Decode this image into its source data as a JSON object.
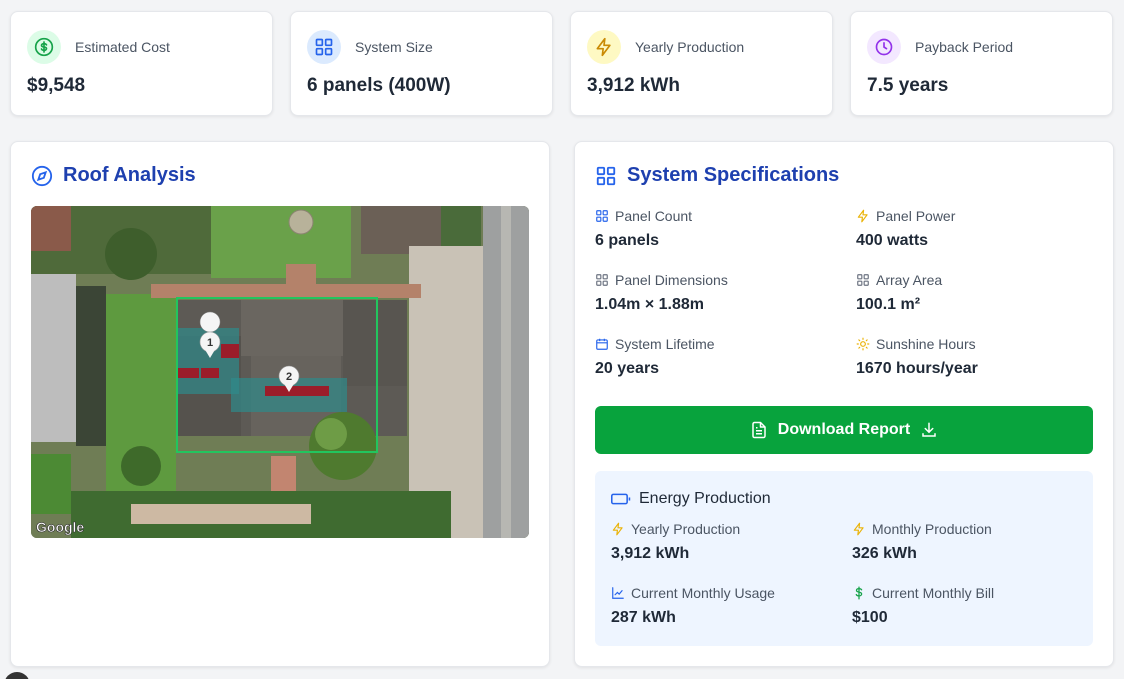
{
  "stats": [
    {
      "label": "Estimated Cost",
      "value": "$9,548",
      "icon": "dollar-icon",
      "color": "#16a34a",
      "bg": "#dcfce7"
    },
    {
      "label": "System Size",
      "value": "6 panels (400W)",
      "icon": "grid-icon",
      "color": "#2563eb",
      "bg": "#dbeafe"
    },
    {
      "label": "Yearly Production",
      "value": "3,912 kWh",
      "icon": "lightning-icon",
      "color": "#ca8a04",
      "bg": "#fef9c3"
    },
    {
      "label": "Payback Period",
      "value": "7.5 years",
      "icon": "clock-icon",
      "color": "#9333ea",
      "bg": "#f3e8ff"
    }
  ],
  "roof": {
    "title": "Roof Analysis",
    "map_attribution": "Google",
    "markers": [
      "1",
      "2"
    ]
  },
  "specs": {
    "title": "System Specifications",
    "items": [
      {
        "label": "Panel Count",
        "value": "6 panels",
        "icon": "grid-icon"
      },
      {
        "label": "Panel Power",
        "value": "400 watts",
        "icon": "lightning-icon"
      },
      {
        "label": "Panel Dimensions",
        "value": "1.04m × 1.88m",
        "icon": "grid-icon"
      },
      {
        "label": "Array Area",
        "value": "100.1 m²",
        "icon": "grid-icon"
      },
      {
        "label": "System Lifetime",
        "value": "20 years",
        "icon": "calendar-icon"
      },
      {
        "label": "Sunshine Hours",
        "value": "1670 hours/year",
        "icon": "sun-icon"
      }
    ],
    "download_label": "Download Report"
  },
  "energy": {
    "title": "Energy Production",
    "items": [
      {
        "label": "Yearly Production",
        "value": "3,912 kWh",
        "icon": "lightning-icon"
      },
      {
        "label": "Monthly Production",
        "value": "326 kWh",
        "icon": "lightning-icon"
      },
      {
        "label": "Current Monthly Usage",
        "value": "287 kWh",
        "icon": "chart-line-icon"
      },
      {
        "label": "Current Monthly Bill",
        "value": "$100",
        "icon": "dollar-icon"
      }
    ]
  },
  "colors": {
    "title_blue": "#1e40af",
    "accent_blue": "#2563eb",
    "button_green": "#08a33d",
    "bolt_yellow": "#eab308"
  }
}
